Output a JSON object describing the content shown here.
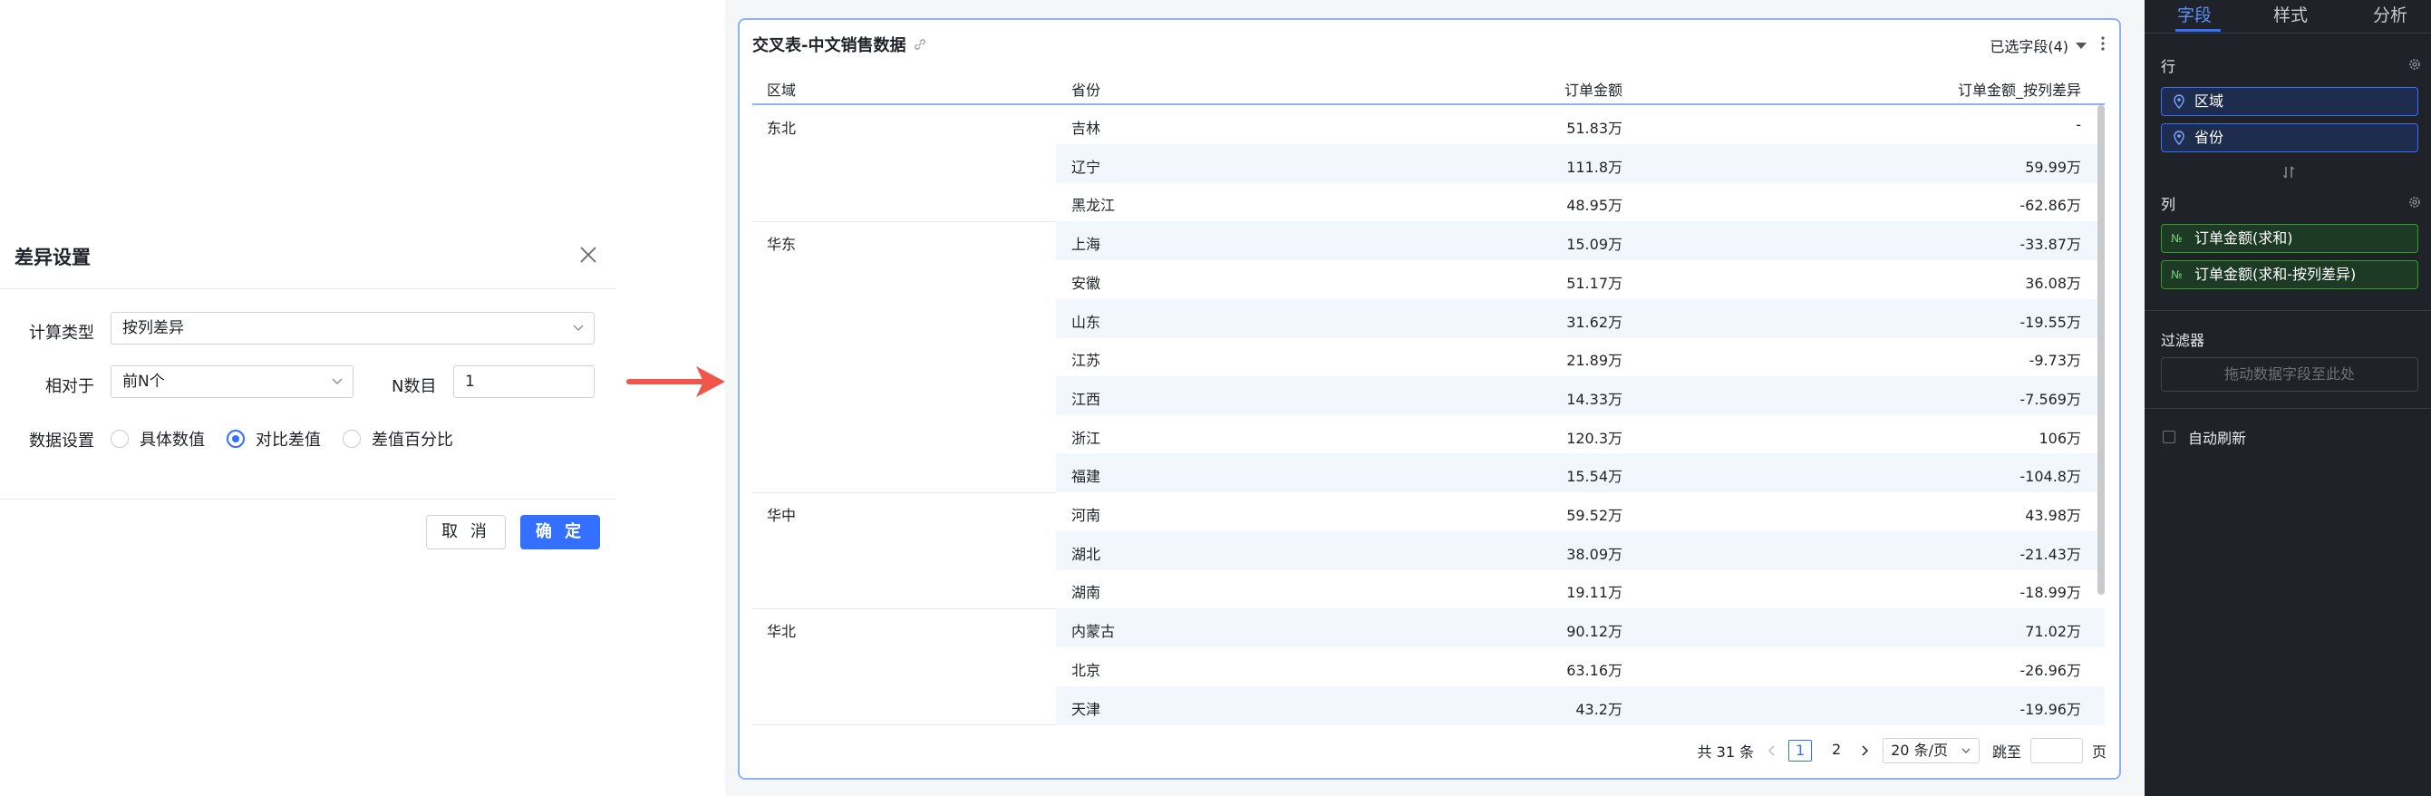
{
  "dialog": {
    "title": "差异设置",
    "calc_type_label": "计算类型",
    "calc_type_value": "按列差异",
    "relative_label": "相对于",
    "relative_value": "前N个",
    "n_label": "N数目",
    "n_value": "1",
    "data_setting_label": "数据设置",
    "radios": [
      {
        "label": "具体数值",
        "checked": false
      },
      {
        "label": "对比差值",
        "checked": true
      },
      {
        "label": "差值百分比",
        "checked": false
      }
    ],
    "cancel_label": "取 消",
    "ok_label": "确 定"
  },
  "card": {
    "title": "交叉表-中文销售数据",
    "fields_label": "已选字段(4)",
    "headers": [
      "区域",
      "省份",
      "订单金额",
      "订单金额_按列差异"
    ],
    "groups": [
      {
        "region": "东北",
        "rows": [
          {
            "province": "吉林",
            "amount": "51.83万",
            "diff": "-"
          },
          {
            "province": "辽宁",
            "amount": "111.8万",
            "diff": "59.99万"
          },
          {
            "province": "黑龙江",
            "amount": "48.95万",
            "diff": "-62.86万"
          }
        ]
      },
      {
        "region": "华东",
        "rows": [
          {
            "province": "上海",
            "amount": "15.09万",
            "diff": "-33.87万"
          },
          {
            "province": "安徽",
            "amount": "51.17万",
            "diff": "36.08万"
          },
          {
            "province": "山东",
            "amount": "31.62万",
            "diff": "-19.55万"
          },
          {
            "province": "江苏",
            "amount": "21.89万",
            "diff": "-9.73万"
          },
          {
            "province": "江西",
            "amount": "14.33万",
            "diff": "-7.569万"
          },
          {
            "province": "浙江",
            "amount": "120.3万",
            "diff": "106万"
          },
          {
            "province": "福建",
            "amount": "15.54万",
            "diff": "-104.8万"
          }
        ]
      },
      {
        "region": "华中",
        "rows": [
          {
            "province": "河南",
            "amount": "59.52万",
            "diff": "43.98万"
          },
          {
            "province": "湖北",
            "amount": "38.09万",
            "diff": "-21.43万"
          },
          {
            "province": "湖南",
            "amount": "19.11万",
            "diff": "-18.99万"
          }
        ]
      },
      {
        "region": "华北",
        "rows": [
          {
            "province": "内蒙古",
            "amount": "90.12万",
            "diff": "71.02万"
          },
          {
            "province": "北京",
            "amount": "63.16万",
            "diff": "-26.96万"
          },
          {
            "province": "天津",
            "amount": "43.2万",
            "diff": "-19.96万"
          }
        ]
      }
    ],
    "pager": {
      "total": "共 31 条",
      "pages": [
        "1",
        "2"
      ],
      "current_page": "1",
      "page_size": "20 条/页",
      "jump_label": "跳至",
      "page_unit": "页"
    }
  },
  "sidebar": {
    "tabs": [
      "字段",
      "样式",
      "分析"
    ],
    "active_tab": "字段",
    "rows_title": "行",
    "row_fields": [
      "区域",
      "省份"
    ],
    "cols_title": "列",
    "col_fields": [
      "订单金额(求和)",
      "订单金额(求和-按列差异)"
    ],
    "measure_icon": "№",
    "filter_title": "过滤器",
    "filter_placeholder": "拖动数据字段至此处",
    "auto_refresh_label": "自动刷新"
  },
  "colors": {
    "accent": "#3370ff",
    "arrow": "#f0564a",
    "sidebar_bg": "#1f2329",
    "stripe": "#f2f6fd"
  }
}
